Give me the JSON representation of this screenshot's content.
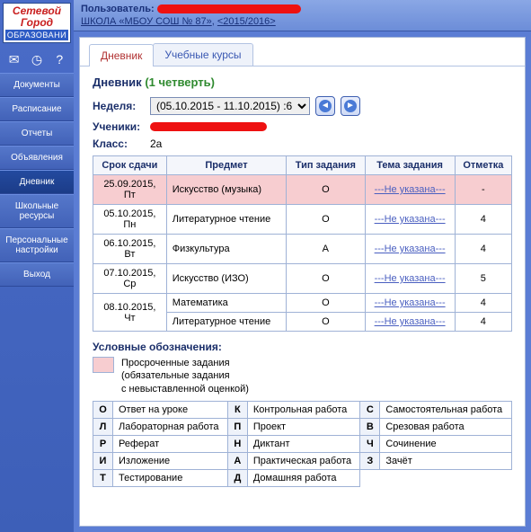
{
  "logo": {
    "line1": "Сетевой",
    "line2": "Город",
    "sub": "ОБРАЗОВАНИ"
  },
  "sideIcons": [
    "mail-icon",
    "globe-icon",
    "help-icon"
  ],
  "nav": [
    {
      "label": "Документы",
      "active": false
    },
    {
      "label": "Расписание",
      "active": false
    },
    {
      "label": "Отчеты",
      "active": false
    },
    {
      "label": "Объявления",
      "active": false
    },
    {
      "label": "Дневник",
      "active": true
    },
    {
      "label": "Школьные ресурсы",
      "active": false
    },
    {
      "label": "Персональные настройки",
      "active": false
    },
    {
      "label": "Выход",
      "active": false
    }
  ],
  "header": {
    "user_label": "Пользователь:",
    "school_link": "ШКОЛА «МБОУ СОШ № 87»",
    "year_link": "<2015/2016>"
  },
  "tabs": [
    {
      "label": "Дневник",
      "active": true
    },
    {
      "label": "Учебные курсы",
      "active": false
    }
  ],
  "page": {
    "title": "Дневник",
    "quarter": "(1 четверть)",
    "week_label": "Неделя:",
    "week_value": "(05.10.2015 - 11.10.2015) :6",
    "students_label": "Ученики:",
    "class_label": "Класс:",
    "class_value": "2а"
  },
  "columns": {
    "due": "Срок сдачи",
    "subject": "Предмет",
    "type": "Тип задания",
    "topic": "Тема задания",
    "mark": "Отметка"
  },
  "rows": [
    {
      "date": "25.09.2015, Пт",
      "subject": "Искусство (музыка)",
      "type": "О",
      "topic": "---Не указана---",
      "mark": "-",
      "overdue": true,
      "rowspan": 1
    },
    {
      "date": "05.10.2015, Пн",
      "subject": "Литературное чтение",
      "type": "О",
      "topic": "---Не указана---",
      "mark": "4",
      "overdue": false,
      "rowspan": 1
    },
    {
      "date": "06.10.2015, Вт",
      "subject": "Физкультура",
      "type": "А",
      "topic": "---Не указана---",
      "mark": "4",
      "overdue": false,
      "rowspan": 1
    },
    {
      "date": "07.10.2015, Ср",
      "subject": "Искусство (ИЗО)",
      "type": "О",
      "topic": "---Не указана---",
      "mark": "5",
      "overdue": false,
      "rowspan": 1
    },
    {
      "date": "08.10.2015, Чт",
      "subject": "Математика",
      "type": "О",
      "topic": "---Не указана---",
      "mark": "4",
      "overdue": false,
      "rowspan": 2
    },
    {
      "date": "",
      "subject": "Литературное чтение",
      "type": "О",
      "topic": "---Не указана---",
      "mark": "4",
      "overdue": false,
      "rowspan": 0
    }
  ],
  "legend": {
    "title": "Условные обозначения:",
    "overdue_l1": "Просроченные задания",
    "overdue_l2": "(обязательные задания",
    "overdue_l3": "с невыставленной оценкой)"
  },
  "types": [
    [
      {
        "c": "О",
        "t": "Ответ на уроке"
      },
      {
        "c": "К",
        "t": "Контрольная работа"
      },
      {
        "c": "С",
        "t": "Самостоятельная работа"
      }
    ],
    [
      {
        "c": "Л",
        "t": "Лабораторная работа"
      },
      {
        "c": "П",
        "t": "Проект"
      },
      {
        "c": "В",
        "t": "Срезовая работа"
      }
    ],
    [
      {
        "c": "Р",
        "t": "Реферат"
      },
      {
        "c": "Н",
        "t": "Диктант"
      },
      {
        "c": "Ч",
        "t": "Сочинение"
      }
    ],
    [
      {
        "c": "И",
        "t": "Изложение"
      },
      {
        "c": "А",
        "t": "Практическая работа"
      },
      {
        "c": "З",
        "t": "Зачёт"
      }
    ],
    [
      {
        "c": "Т",
        "t": "Тестирование"
      },
      {
        "c": "Д",
        "t": "Домашняя работа"
      },
      {
        "c": "",
        "t": ""
      }
    ]
  ]
}
